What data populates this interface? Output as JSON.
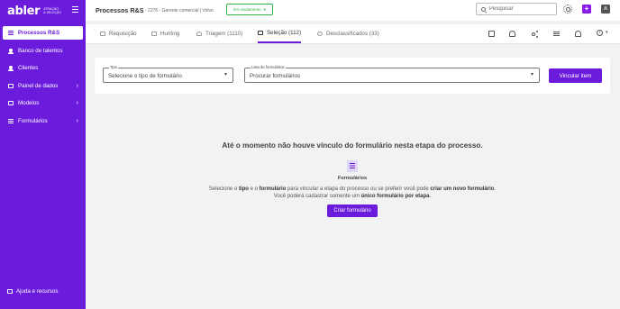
{
  "brand": {
    "name": "abler",
    "tagline_line1": "ATRAÇÃO",
    "tagline_line2": "& SELEÇÃO"
  },
  "sidebar": {
    "items": [
      {
        "label": "Processos R&S",
        "active": true
      },
      {
        "label": "Banco de talentos"
      },
      {
        "label": "Clientes"
      },
      {
        "label": "Painel de dados",
        "chevron": true
      },
      {
        "label": "Modelos",
        "chevron": true
      },
      {
        "label": "Formulários",
        "chevron": true
      }
    ],
    "help_label": "Ajuda e recursos"
  },
  "header": {
    "title": "Processos R&S",
    "subtitle": "- 2276 - Gerente comercial | Volvo",
    "status": "Em andamento",
    "search_placeholder": "Pesquisar",
    "plus": "+",
    "avatar_initial": "A"
  },
  "tabs": [
    {
      "label": "Requisição"
    },
    {
      "label": "Hunting"
    },
    {
      "label": "Triagem (1110)"
    },
    {
      "label": "Seleção (112)",
      "active": true
    },
    {
      "label": "Desclassificados (33)"
    }
  ],
  "form": {
    "tipo_label": "Tipo",
    "tipo_placeholder": "Selecione o tipo de formulário",
    "lista_label": "Lista de formulários",
    "lista_placeholder": "Procurar formulários",
    "vincular_label": "Vincular item"
  },
  "empty_state": {
    "title": "Até o momento não houve vínculo do formulário nesta etapa do processo.",
    "icon_label": "Formulários",
    "line1_a": "Selecione o ",
    "line1_b": "tipo",
    "line1_c": " e o ",
    "line1_d": "formulário",
    "line1_e": " para vincular a etapa do processo ou se preferir você pode ",
    "line1_f": "criar um novo formulário",
    "line1_g": ".",
    "line2_a": "Você poderá cadastrar somente um ",
    "line2_b": "único formulário por etapa",
    "line2_c": ".",
    "button_label": "Criar formulário"
  },
  "colors": {
    "primary": "#6a1bdc",
    "status_green": "#2db34a",
    "background": "#f2f2f4"
  }
}
